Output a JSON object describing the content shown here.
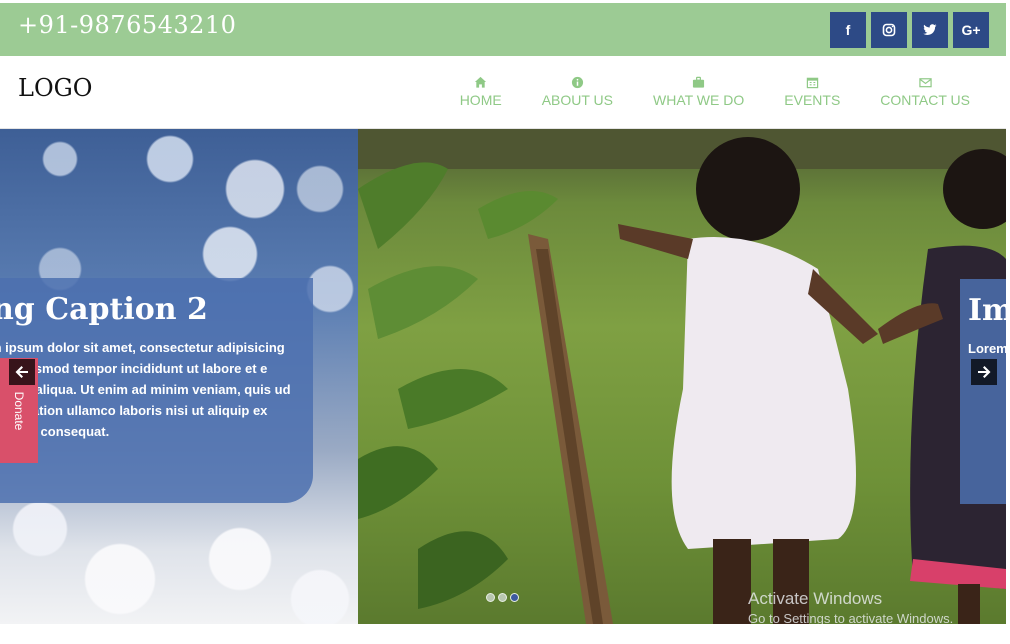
{
  "topbar": {
    "phone": "+91-9876543210",
    "socials": [
      {
        "icon": "facebook-icon",
        "glyph": "f"
      },
      {
        "icon": "instagram-icon",
        "glyph": "◎"
      },
      {
        "icon": "twitter-icon",
        "glyph": "t"
      },
      {
        "icon": "google-plus-icon",
        "glyph": "G+"
      }
    ]
  },
  "navbar": {
    "logo": "LOGO",
    "items": [
      {
        "label": "HOME",
        "icon": "home-icon"
      },
      {
        "label": "ABOUT US",
        "icon": "info-icon"
      },
      {
        "label": "WHAT WE DO",
        "icon": "briefcase-icon"
      },
      {
        "label": "EVENTS",
        "icon": "calendar-icon"
      },
      {
        "label": "CONTACT US",
        "icon": "envelope-icon"
      }
    ]
  },
  "slider": {
    "caption": {
      "title": "ng Caption 2",
      "body": "m ipsum dolor sit amet, consectetur adipisicing sed eiusmod tempor incididunt ut labore et e magna aliqua. Ut enim ad minim veniam, quis ud exercitation ullamco laboris nisi ut aliquip ex mmodo consequat."
    },
    "next_caption": {
      "title": "Im",
      "body": "Lorem non nostru ea co"
    },
    "donate_label": "Donate",
    "dots_count": 3,
    "active_dot": 3
  },
  "watermark": {
    "title": "Activate Windows",
    "subtitle": "Go to Settings to activate Windows."
  },
  "colors": {
    "topbar": "#9ccb94",
    "social_bg": "#2d4a86",
    "nav_text": "#8fc986",
    "caption_bg": "#4c70af",
    "donate_bg": "#d9506a"
  }
}
